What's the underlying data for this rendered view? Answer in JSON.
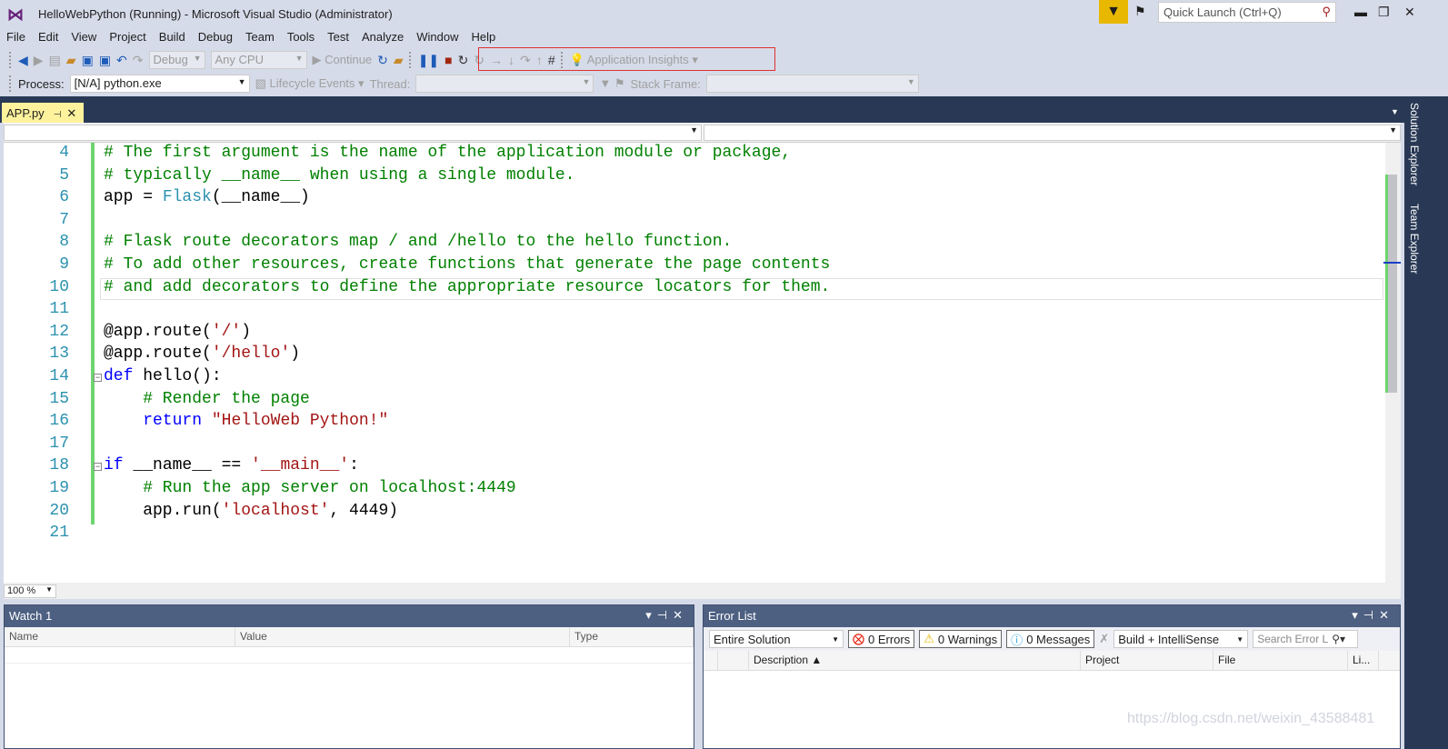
{
  "window": {
    "title": "HelloWebPython (Running) - Microsoft Visual Studio  (Administrator)",
    "quick_launch_placeholder": "Quick Launch (Ctrl+Q)"
  },
  "menu": [
    "File",
    "Edit",
    "View",
    "Project",
    "Build",
    "Debug",
    "Team",
    "Tools",
    "Test",
    "Analyze",
    "Window",
    "Help"
  ],
  "toolbar": {
    "config": "Debug",
    "platform": "Any CPU",
    "continue": "Continue",
    "app_insights": "Application Insights"
  },
  "debug_location": {
    "process_label": "Process:",
    "process": "[N/A] python.exe",
    "lifecycle": "Lifecycle Events",
    "thread_label": "Thread:",
    "stack_label": "Stack Frame:"
  },
  "tab": {
    "name": "APP.py"
  },
  "side_tabs": [
    "Solution Explorer",
    "Team Explorer"
  ],
  "editor": {
    "zoom": "100 %",
    "lines": [
      {
        "n": "4",
        "t": [
          [
            "c",
            "# The first argument is the name of the application module or package,"
          ]
        ]
      },
      {
        "n": "5",
        "t": [
          [
            "c",
            "# typically __name__ when using a single module."
          ]
        ]
      },
      {
        "n": "6",
        "t": [
          [
            "",
            "app = "
          ],
          [
            "t",
            "Flask"
          ],
          [
            "",
            "(__name__)"
          ]
        ]
      },
      {
        "n": "7",
        "t": []
      },
      {
        "n": "8",
        "t": [
          [
            "c",
            "# Flask route decorators map / and /hello to the hello function."
          ]
        ]
      },
      {
        "n": "9",
        "t": [
          [
            "c",
            "# To add other resources, create functions that generate the page contents"
          ]
        ]
      },
      {
        "n": "10",
        "t": [
          [
            "c",
            "# and add decorators to define the appropriate resource locators for them."
          ]
        ]
      },
      {
        "n": "11",
        "t": []
      },
      {
        "n": "12",
        "t": [
          [
            "",
            "@app.route("
          ],
          [
            "s",
            "'/'"
          ],
          [
            "",
            ")"
          ]
        ]
      },
      {
        "n": "13",
        "t": [
          [
            "",
            "@app.route("
          ],
          [
            "s",
            "'/hello'"
          ],
          [
            "",
            ")"
          ]
        ]
      },
      {
        "n": "14",
        "t": [
          [
            "k",
            "def"
          ],
          [
            "",
            " hello():"
          ]
        ]
      },
      {
        "n": "15",
        "t": [
          [
            "c",
            "    # Render the page"
          ]
        ]
      },
      {
        "n": "16",
        "t": [
          [
            "k",
            "    return"
          ],
          [
            "",
            " "
          ],
          [
            "s",
            "\"HelloWeb Python!\""
          ]
        ]
      },
      {
        "n": "17",
        "t": []
      },
      {
        "n": "18",
        "t": [
          [
            "k",
            "if"
          ],
          [
            "",
            " __name__ == "
          ],
          [
            "s",
            "'__main__'"
          ],
          [
            "",
            ":"
          ]
        ]
      },
      {
        "n": "19",
        "t": [
          [
            "c",
            "    # Run the app server on localhost:4449"
          ]
        ]
      },
      {
        "n": "20",
        "t": [
          [
            "",
            "    app.run("
          ],
          [
            "s",
            "'localhost'"
          ],
          [
            "",
            ", 4449)"
          ]
        ]
      },
      {
        "n": "21",
        "t": []
      }
    ]
  },
  "watch": {
    "title": "Watch 1",
    "columns": [
      "Name",
      "Value",
      "Type"
    ]
  },
  "error_list": {
    "title": "Error List",
    "scope": "Entire Solution",
    "errors": "0 Errors",
    "warnings": "0 Warnings",
    "messages": "0 Messages",
    "source": "Build + IntelliSense",
    "search_placeholder": "Search Error L",
    "columns": [
      "Description",
      "Project",
      "File",
      "Li..."
    ]
  },
  "watermark": "https://blog.csdn.net/weixin_43588481",
  "colors": {
    "accent": "#68217a",
    "tab_active": "#fff29d",
    "panel_header": "#4d6082",
    "dark_band": "#293955",
    "comment": "#008000",
    "keyword": "#0000ff",
    "string": "#a31515"
  }
}
